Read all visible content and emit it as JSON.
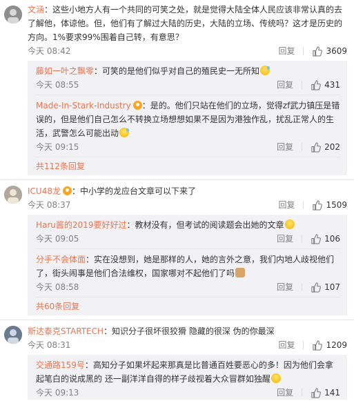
{
  "accent_color": "#eb7350",
  "icons": {
    "like": "thumb-up-icon",
    "vip": "vip-badge-icon"
  },
  "comments": [
    {
      "user": "文涵",
      "text": "这些小地方人有一个共同的可笑之处，就是觉得大陆全体人民应该非常认真的去了解他，体谅他。但，他们有了解过大陆的历史，大陆的立场、传统吗？这才是历史的方向。1%要求99%围着自己转，有意思？",
      "time": "今天 08:42",
      "reply_label": "回复",
      "likes": "3609",
      "replies": [
        {
          "user": "藤如一叶之飘零",
          "text": "可笑的是他们似乎对自己的殖民史一无所知",
          "time": "今天 08:55",
          "reply_label": "回复",
          "likes": "431"
        },
        {
          "user": "Made-In-Stark-Industry",
          "text": "是的。他们只站在他们的立场，觉得zf武力镇压是错误的，但是他们自己怎么不转换立场想想如果不是因为港独作乱，扰乱正常人的生活，武警怎么可能出动",
          "time": "今天 09:15",
          "reply_label": "回复",
          "likes": "202"
        }
      ],
      "more": "共112条回复"
    },
    {
      "user": "ICU48龙",
      "text": "中小学的龙应台文章可以下来了",
      "time": "今天 08:37",
      "reply_label": "回复",
      "likes": "1509",
      "replies": [
        {
          "user": "Haru酱的2019要好好过",
          "text": "教材没有，但考试的阅读题会出她的文章",
          "time": "今天 09:05",
          "reply_label": "回复",
          "likes": "106"
        },
        {
          "user": "分手不会体面",
          "text": "实在没想到，她是那样的人，她的言外之意，我们内地人歧视他们了，街头闹事是他们合法维权，国家哪对不起他们了吗",
          "time": "今天 08:58",
          "reply_label": "回复",
          "likes": "107"
        }
      ],
      "more": "共60条回复"
    },
    {
      "user": "斯达泰克STARTECH",
      "text": "知识分子很坏很狡猾 隐藏的很深 伪的你最深",
      "time": "今天 08:31",
      "reply_label": "回复",
      "likes": "1209",
      "replies": [
        {
          "user": "交通路159号",
          "text": "高知分子如果坏起来那真是比普通百姓要恶心的多！因为他们会拿起笔白的说成黑的 还一副洋洋自得的样子歧视着大众冒群如独醒",
          "time": "今天 09:13",
          "reply_label": "回复",
          "likes": "141"
        }
      ]
    }
  ]
}
